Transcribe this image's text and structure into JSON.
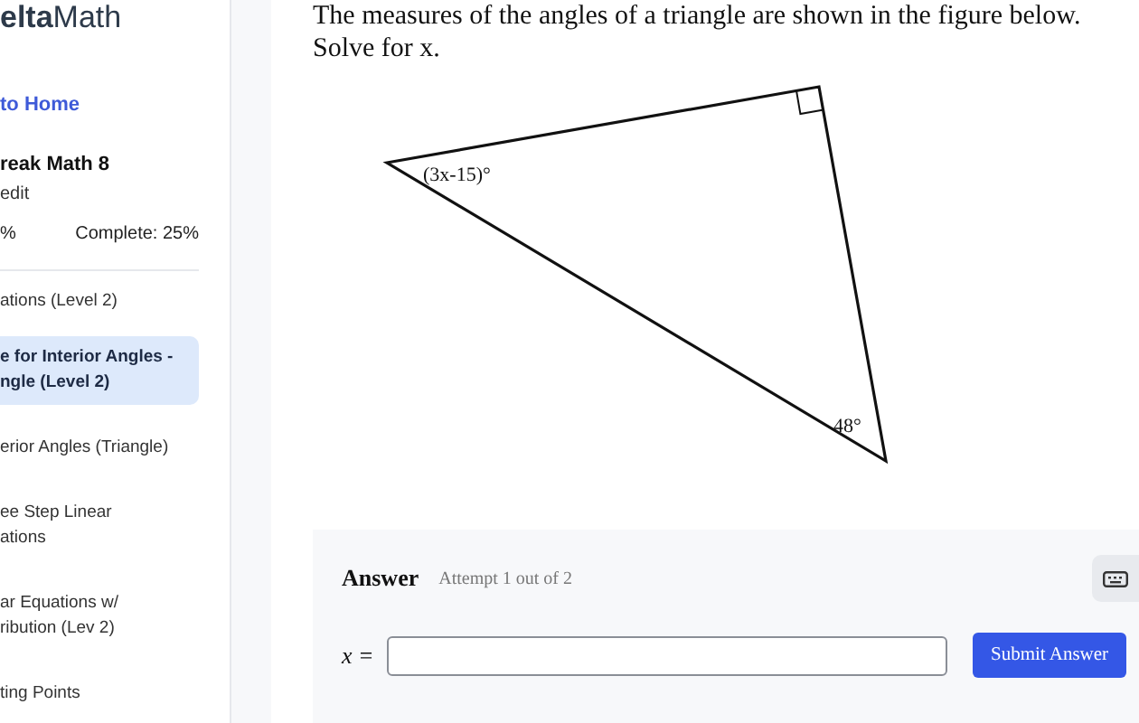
{
  "logo": {
    "text": "**elta**Math"
  },
  "back_link": "to Home",
  "assignment": {
    "title": "reak Math 8",
    "subtitle": "edit",
    "grade": "%",
    "complete": "Complete: 25%"
  },
  "skills": [
    {
      "lines": [
        "ations (Level 2)"
      ],
      "selected": false
    },
    {
      "lines": [
        "e for Interior Angles -",
        "ngle (Level 2)"
      ],
      "selected": true
    },
    {
      "lines": [
        "erior Angles (Triangle)"
      ],
      "selected": false
    },
    {
      "lines": [
        "ee Step Linear",
        "ations"
      ],
      "selected": false
    },
    {
      "lines": [
        "ar Equations w/",
        "ribution (Lev 2)"
      ],
      "selected": false
    },
    {
      "lines": [
        "ting Points"
      ],
      "selected": false
    }
  ],
  "question": {
    "text": "The measures of the angles of a triangle are shown in the figure below.",
    "prompt": "Solve for x."
  },
  "figure": {
    "labels": [
      "(3x-15)°",
      "48°"
    ]
  },
  "answer": {
    "heading": "Answer",
    "attempt": "Attempt 1 out of 2",
    "variable": "x =",
    "button": "Submit Answer"
  }
}
